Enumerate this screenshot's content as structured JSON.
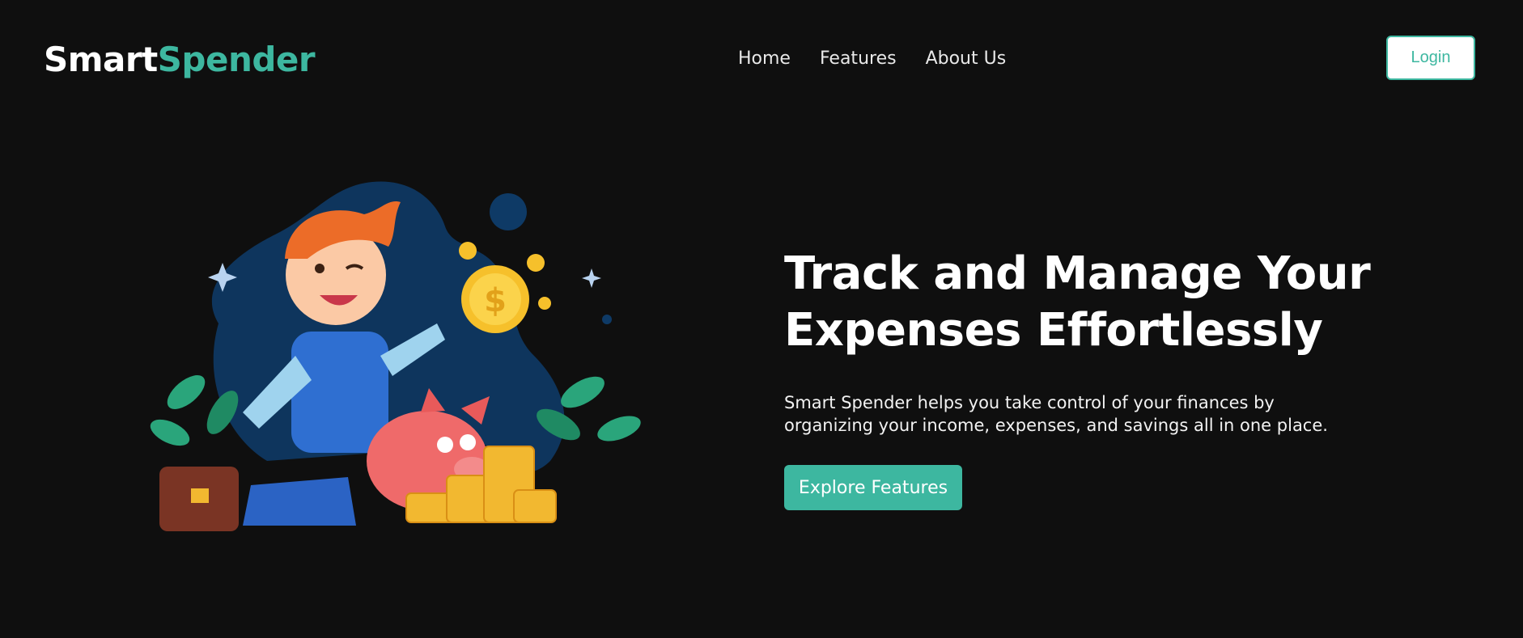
{
  "brand": {
    "first": "Smart",
    "second": "Spender",
    "accent_color": "#3db7a0"
  },
  "nav": {
    "links": [
      {
        "label": "Home"
      },
      {
        "label": "Features"
      },
      {
        "label": "About Us"
      }
    ],
    "login_label": "Login"
  },
  "hero": {
    "title": "Track and Manage Your Expenses Effortlessly",
    "description": "Smart Spender helps you take control of your finances by organizing your income, expenses, and savings all in one place.",
    "cta_label": "Explore Features",
    "illustration_icon": "boy-with-piggy-bank-and-coins-illustration"
  },
  "colors": {
    "background": "#0f0f0f",
    "accent": "#3db7a0",
    "text": "#ffffff"
  }
}
